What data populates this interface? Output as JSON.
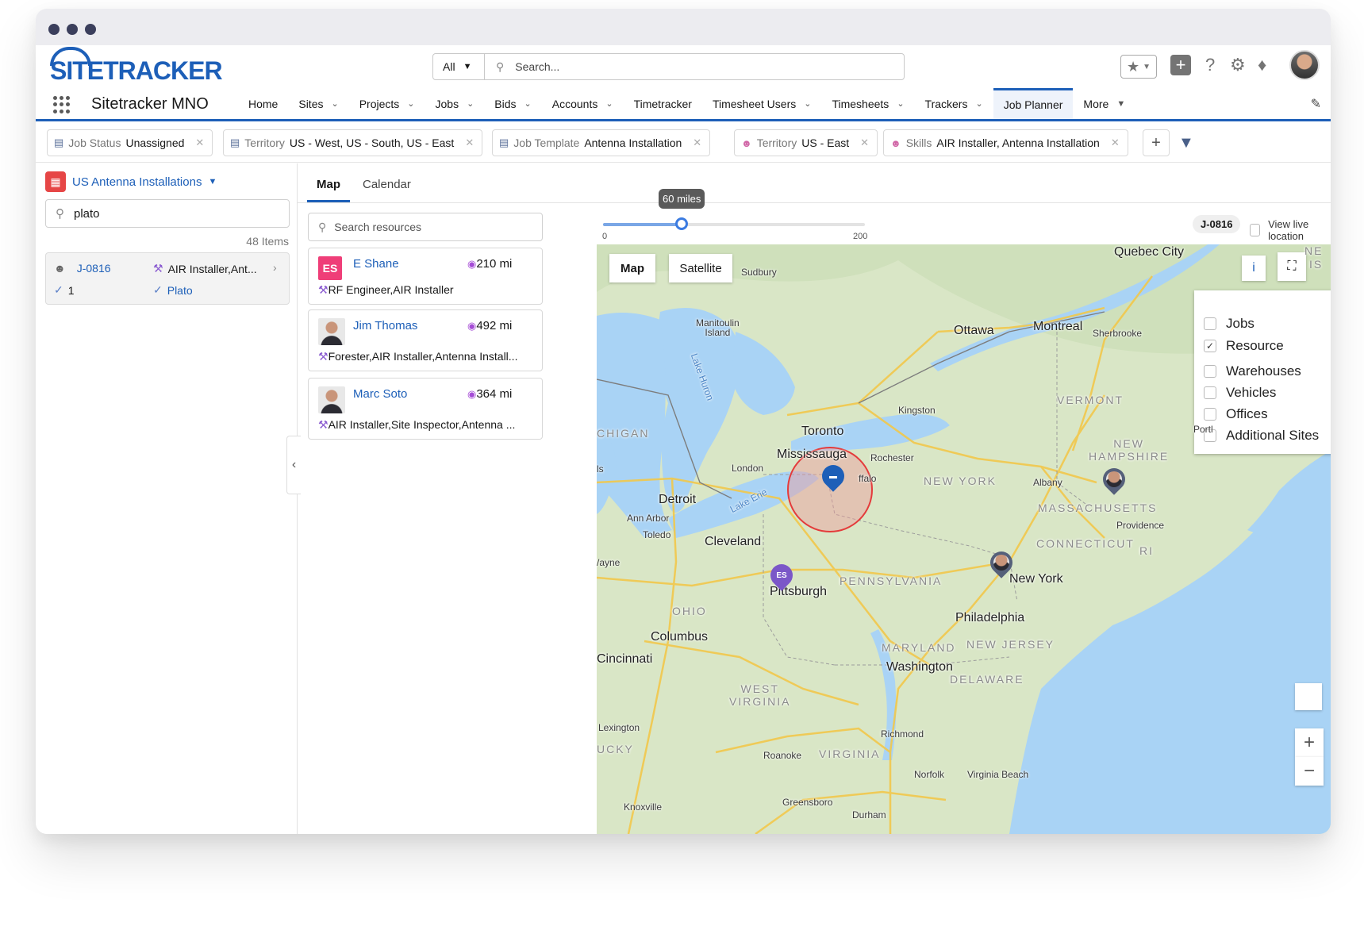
{
  "brand": {
    "logo_text": "SITETRACKER",
    "app_name": "Sitetracker MNO"
  },
  "search": {
    "scope": "All",
    "placeholder": "Search..."
  },
  "nav": {
    "items": [
      {
        "label": "Home",
        "has_menu": false
      },
      {
        "label": "Sites",
        "has_menu": true
      },
      {
        "label": "Projects",
        "has_menu": true
      },
      {
        "label": "Jobs",
        "has_menu": true
      },
      {
        "label": "Bids",
        "has_menu": true
      },
      {
        "label": "Accounts",
        "has_menu": true
      },
      {
        "label": "Timetracker",
        "has_menu": false
      },
      {
        "label": "Timesheet Users",
        "has_menu": true
      },
      {
        "label": "Timesheets",
        "has_menu": true
      },
      {
        "label": "Trackers",
        "has_menu": true
      },
      {
        "label": "Job Planner",
        "has_menu": false,
        "active": true
      },
      {
        "label": "More",
        "has_menu": true
      }
    ]
  },
  "filters": [
    {
      "key": "Job Status",
      "value": "Unassigned",
      "icon": "briefcase-icon"
    },
    {
      "key": "Territory",
      "value": "US - West, US - South, US - East",
      "icon": "briefcase-icon"
    },
    {
      "key": "Job Template",
      "value": "Antenna Installation",
      "icon": "briefcase-icon"
    },
    {
      "key": "Territory",
      "value": "US - East",
      "icon": "person-icon"
    },
    {
      "key": "Skills",
      "value": "AIR Installer, Antenna Installation",
      "icon": "person-icon"
    }
  ],
  "left_panel": {
    "list_view": "US Antenna Installations",
    "search_value": "plato",
    "items_count": "48 Items",
    "job": {
      "id": "J-0816",
      "skills": "AIR Installer,Ant...",
      "count": "1",
      "site": "Plato"
    }
  },
  "tabs": [
    {
      "label": "Map",
      "active": true
    },
    {
      "label": "Calendar",
      "active": false
    }
  ],
  "resources": {
    "search_placeholder": "Search resources",
    "items": [
      {
        "initials": "ES",
        "name": "E Shane",
        "distance": "210 mi",
        "skills": "RF Engineer,AIR Installer"
      },
      {
        "initials": "",
        "name": "Jim Thomas",
        "distance": "492 mi",
        "skills": "Forester,AIR Installer,Antenna Install..."
      },
      {
        "initials": "",
        "name": "Marc Soto",
        "distance": "364 mi",
        "skills": "AIR Installer,Site Inspector,Antenna ..."
      }
    ]
  },
  "radius": {
    "label": "60 miles",
    "min": "0",
    "max": "200",
    "value": 60,
    "max_value": 200
  },
  "job_badge": "J-0816",
  "live_location": "View live location",
  "map": {
    "type_buttons": [
      "Map",
      "Satellite"
    ],
    "legend": [
      {
        "label": "Jobs",
        "checked": false
      },
      {
        "label": "Resource",
        "checked": true
      },
      {
        "label": "Warehouses",
        "checked": false
      },
      {
        "label": "Vehicles",
        "checked": false
      },
      {
        "label": "Offices",
        "checked": false
      },
      {
        "label": "Additional Sites",
        "checked": false
      }
    ],
    "places": {
      "quebec": "Quebec City",
      "sudbury": "Sudbury",
      "manitoulin": "Manitoulin\nIsland",
      "ottawa": "Ottawa",
      "montreal": "Montreal",
      "sherbrooke": "Sherbrooke",
      "vermont": "VERMONT",
      "kingston": "Kingston",
      "toronto": "Toronto",
      "mississauga": "Mississauga",
      "rochester": "Rochester",
      "michigan": "CHIGAN",
      "london": "London",
      "newhampshire": "NEW\nHAMPSHIRE",
      "portland": "Portl",
      "newyork_state": "NEW YORK",
      "albany": "Albany",
      "buffalo": "ffalo",
      "detroit": "Detroit",
      "annarbor": "Ann Arbor",
      "toledo": "Toledo",
      "massachusetts": "MASSACHUSETTS",
      "providence": "Providence",
      "cleveland": "Cleveland",
      "connecticut": "CONNECTICUT",
      "ri": "RI",
      "wayne": "/ayne",
      "pittsburgh": "Pittsburgh",
      "pennsylvania": "PENNSYLVANIA",
      "newyork": "New York",
      "ohio": "OHIO",
      "columbus": "Columbus",
      "philadelphia": "Philadelphia",
      "cincinnati": "Cincinnati",
      "maryland": "MARYLAND",
      "newjersey": "NEW JERSEY",
      "washington": "Washington",
      "delaware": "DELAWARE",
      "westvirginia": "WEST\nVIRGINIA",
      "lexington": "Lexington",
      "richmond": "Richmond",
      "kentucky": "UCKY",
      "roanoke": "Roanoke",
      "virginia": "VIRGINIA",
      "norfolk": "Norfolk",
      "virginiabeach": "Virginia Beach",
      "knoxville": "Knoxville",
      "greensboro": "Greensboro",
      "durham": "Durham",
      "ne": "NE",
      "is": "IS",
      "laked_huron": "Lake Huron",
      "lake_erie": "Lake Erie",
      "is_left": "ls"
    },
    "pin_label": "ES"
  },
  "colors": {
    "brand": "#1d5fb8",
    "es_avatar": "#ef3e78",
    "calendar_icon": "#e64646",
    "radius_circle": "#e43b3b",
    "resource_pin": "#7b57c8"
  }
}
